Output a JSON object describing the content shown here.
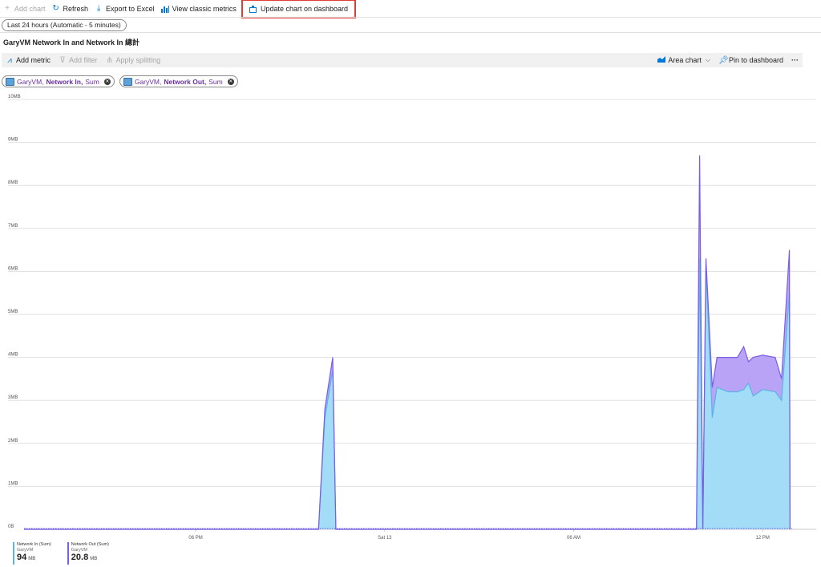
{
  "toolbar": {
    "add_chart": "Add chart",
    "refresh": "Refresh",
    "export": "Export to Excel",
    "classic": "View classic metrics",
    "update_dashboard": "Update chart on dashboard"
  },
  "time_range": "Last 24 hours (Automatic - 5 minutes)",
  "chart_title": "GaryVM Network In and Network In 總計",
  "chart_toolbar": {
    "add_metric": "Add metric",
    "add_filter": "Add filter",
    "apply_splitting": "Apply splitting",
    "chart_type": "Area chart",
    "pin": "Pin to dashboard",
    "more": "···"
  },
  "pills": [
    {
      "resource": "GaryVM,",
      "metric": "Network In,",
      "agg": "Sum"
    },
    {
      "resource": "GaryVM,",
      "metric": "Network Out,",
      "agg": "Sum"
    }
  ],
  "legend": [
    {
      "name": "Network In (Sum)",
      "resource": "GaryVM",
      "value": "94",
      "unit": "MB",
      "color": "#5ab4e6"
    },
    {
      "name": "Network Out (Sum)",
      "resource": "GaryVM",
      "value": "20.8",
      "unit": "MB",
      "color": "#7b5be8"
    }
  ],
  "colors": {
    "network_in_fill": "#a3dcf6",
    "network_in_line": "#5ab4e6",
    "network_out_fill": "#b9a3f7",
    "network_out_line": "#7b5be8"
  },
  "chart_data": {
    "type": "area",
    "ylim": [
      0,
      10
    ],
    "y_unit": "MB",
    "y_ticks": [
      "0B",
      "1MB",
      "2MB",
      "3MB",
      "4MB",
      "5MB",
      "6MB",
      "7MB",
      "8MB",
      "9MB",
      "10MB"
    ],
    "x_ticks": [
      "06 PM",
      "Sat 13",
      "06 AM",
      "12 PM"
    ],
    "x_tick_hours": [
      5,
      11,
      17,
      23
    ],
    "xlim_hours": [
      -0.45,
      24.7
    ],
    "stacked": true,
    "series": [
      {
        "name": "Network In (Sum)",
        "points": [
          [
            -0.45,
            0
          ],
          [
            8.9,
            0
          ],
          [
            9.1,
            2.6
          ],
          [
            9.35,
            3.7
          ],
          [
            9.45,
            0
          ],
          [
            20.9,
            0
          ],
          [
            21.0,
            6.3
          ],
          [
            21.1,
            0
          ],
          [
            21.2,
            6.1
          ],
          [
            21.4,
            2.6
          ],
          [
            21.55,
            3.3
          ],
          [
            21.9,
            3.2
          ],
          [
            22.2,
            3.2
          ],
          [
            22.4,
            3.25
          ],
          [
            22.55,
            3.4
          ],
          [
            22.7,
            3.1
          ],
          [
            23.0,
            3.25
          ],
          [
            23.4,
            3.2
          ],
          [
            23.6,
            3.0
          ],
          [
            23.85,
            5.5
          ],
          [
            23.87,
            0
          ]
        ]
      },
      {
        "name": "Network Out (Sum)",
        "points": [
          [
            -0.45,
            0
          ],
          [
            8.9,
            0
          ],
          [
            9.1,
            0.2
          ],
          [
            9.35,
            0.3
          ],
          [
            9.45,
            0
          ],
          [
            20.9,
            0
          ],
          [
            21.0,
            2.4
          ],
          [
            21.1,
            0
          ],
          [
            21.2,
            0.2
          ],
          [
            21.4,
            0.7
          ],
          [
            21.55,
            0.7
          ],
          [
            21.9,
            0.8
          ],
          [
            22.2,
            0.8
          ],
          [
            22.4,
            1.0
          ],
          [
            22.55,
            0.5
          ],
          [
            22.7,
            0.9
          ],
          [
            23.0,
            0.8
          ],
          [
            23.4,
            0.8
          ],
          [
            23.6,
            0.5
          ],
          [
            23.85,
            1.0
          ],
          [
            23.87,
            0
          ]
        ]
      }
    ]
  }
}
